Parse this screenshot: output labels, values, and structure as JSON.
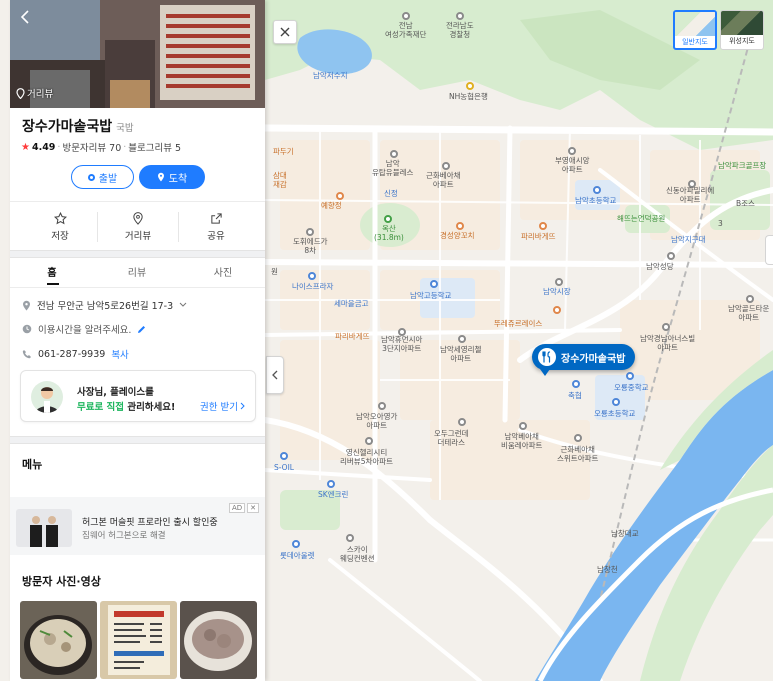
{
  "place": {
    "name": "장수가마솥국밥",
    "category": "국밥",
    "rating": "4.49",
    "visitor_reviews": "방문자리뷰 70",
    "blog_reviews": "블로그리뷰 5",
    "street_view_label": "거리뷰"
  },
  "route": {
    "depart": "출발",
    "arrive": "도착"
  },
  "actions": {
    "save": "저장",
    "roadview": "거리뷰",
    "share": "공유"
  },
  "tabs": [
    "홈",
    "리뷰",
    "사진"
  ],
  "info": {
    "address": "전남 무안군 남악5로26번길 17-3",
    "hours": "이용시간을 알려주세요.",
    "phone": "061-287-9939",
    "copy": "복사"
  },
  "banner": {
    "line1": "사장님, 플레이스를",
    "highlight": "무료로 직접",
    "line2_rest": " 관리하세요!",
    "link": "권한 받기"
  },
  "sections": {
    "menu": "메뉴",
    "visitor_media": "방문자 사진·영상"
  },
  "ad": {
    "badge": "AD",
    "title": "허그본 머슬핏 프로라인 출시 할인중",
    "subtitle": "짐웨어 허그본으로 해결"
  },
  "map": {
    "marker_label": "장수가마솥국밥",
    "layer_normal": "일반지도",
    "layer_satellite": "위성지도",
    "labels": {
      "l1": "전남\n여성가족재단",
      "l2": "전라남도\n경찰청",
      "l3": "남악저수지",
      "l4": "NH농협은행",
      "l5": "남악\n유탑유블레스",
      "l6": "근화베아채\n아파트",
      "l7": "부영애시앙\n아파트",
      "l8": "남악파크골프장",
      "l9": "신정",
      "l10": "예향정",
      "l11": "도휘에드가\n8차",
      "l12": "옥산\n(31.8m)",
      "l13": "경성양꼬치",
      "l14": "파리바게뜨",
      "l15": "남악초등학교",
      "l16": "신동아파밀리에\n아파트",
      "l17": "해뜨는언덕공원",
      "l18": "남악지구대",
      "l19": "남악성당",
      "l20": "나이스프라자",
      "l21": "세마을금고",
      "l22": "남악고등학교",
      "l23": "남악시장",
      "l24": "남악골드타운\n아파트",
      "l25": "파리바게뜨",
      "l26": "남악휴먼시아\n3단지아파트",
      "l27": "남악세영리첼\n아파트",
      "l28": "뚜레쥬르레이스",
      "l29": "남악경남아너스빌\n아파트",
      "l30": "오룡중학교",
      "l31": "축협",
      "l32": "오룡초등학교",
      "l33": "남악오아영가\n아파트",
      "l34": "오두그런데\n더테라스",
      "l35": "남악베아채\n비움레아파트",
      "l36": "근화베아채\n스위트아파트",
      "l37": "영신헬리시티\n리버뷰5차아파트",
      "l38": "S-OIL",
      "l39": "SK엔크린",
      "l40": "롯데아울렛",
      "l41": "스카이\n웨딩컨벤션",
      "l42": "남창대교",
      "l43": "남창천",
      "l44": "파리바게뜨",
      "l45": "파두기",
      "l46": "삼대\n재감",
      "l47": "원",
      "l48": "B조스",
      "l49": "3"
    }
  },
  "colors": {
    "accent": "#0068c3",
    "primary_blue": "#1f7cff",
    "star": "#ff3c3c",
    "green_text": "#1bb55c",
    "river": "#74b4f2",
    "road": "#ffffff",
    "block": "#f5efe7"
  }
}
